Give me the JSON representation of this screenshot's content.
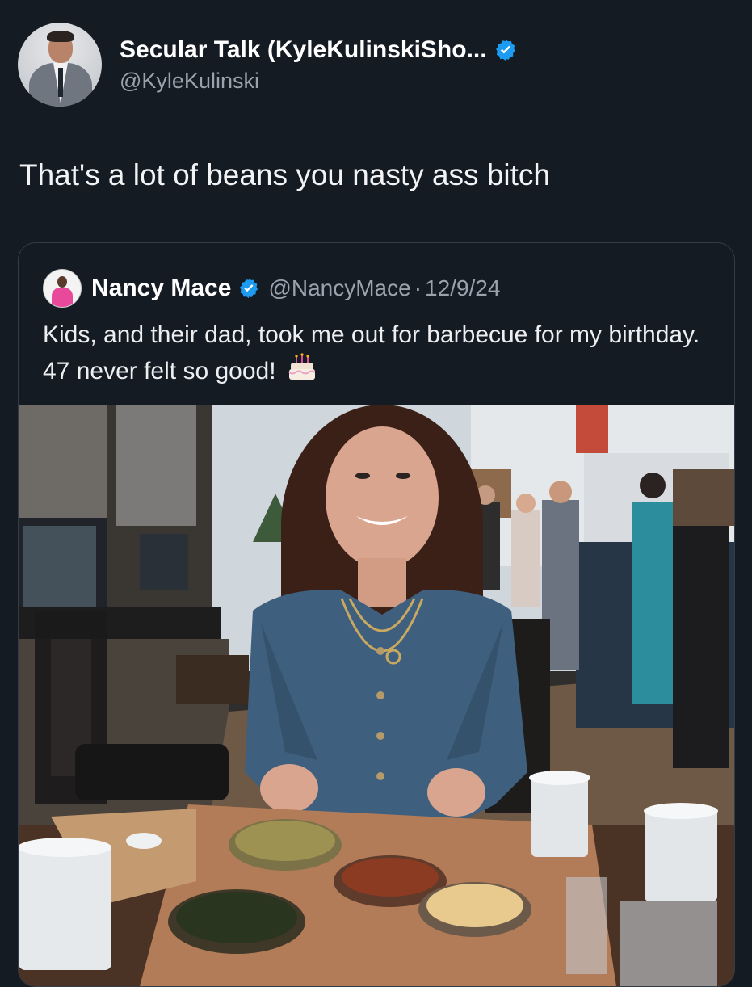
{
  "tweet": {
    "author_name": "Secular Talk (KyleKulinskiSho...",
    "author_handle": "@KyleKulinski",
    "text": "That's a lot of beans you nasty ass bitch"
  },
  "quoted_tweet": {
    "author_name": "Nancy Mace",
    "author_handle": "@NancyMace",
    "separator": "·",
    "date": "12/9/24",
    "text": "Kids, and their dad, took me out for barbecue for my birthday. 47 never felt so good!",
    "emoji": "birthday-cake-icon"
  },
  "colors": {
    "background": "#151b23",
    "verified_badge": "#1d9bf0",
    "secondary_text": "#9aa3ad"
  }
}
